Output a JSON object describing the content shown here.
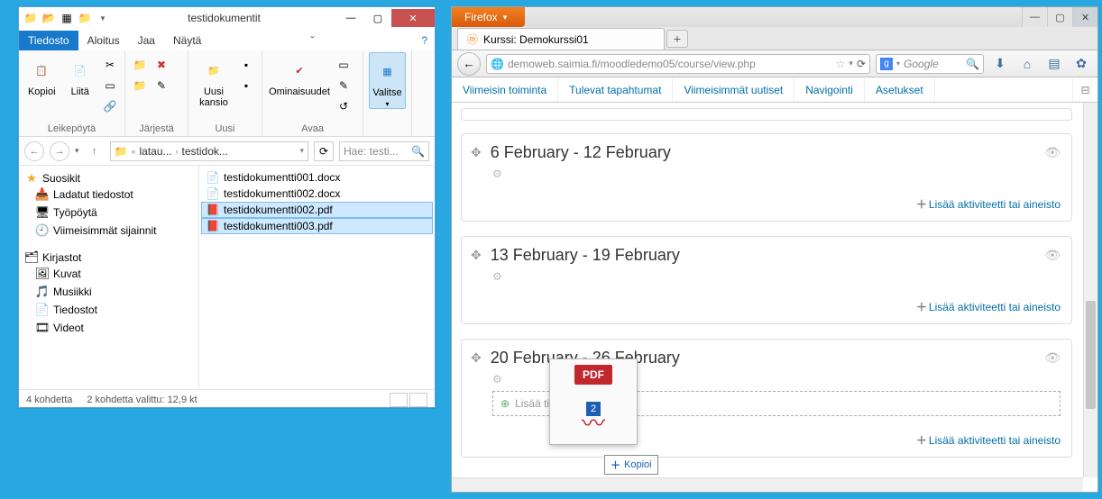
{
  "explorer": {
    "title": "testidokumentit",
    "tabs": {
      "tiedosto": "Tiedosto",
      "aloitus": "Aloitus",
      "jaa": "Jaa",
      "nayta": "Näytä"
    },
    "ribbon": {
      "kopioi": "Kopioi",
      "liita": "Liitä",
      "leikepoyta": "Leikepöytä",
      "jarjesta": "Järjestä",
      "uusi_kansio": "Uusi\nkansio",
      "uusi": "Uusi",
      "ominaisuudet": "Ominaisuudet",
      "avaa": "Avaa",
      "valitse": "Valitse"
    },
    "breadcrumb": {
      "seg1": "latau...",
      "seg2": "testidok..."
    },
    "search_placeholder": "Hae: testi...",
    "tree": {
      "suosikit": "Suosikit",
      "ladatut": "Ladatut tiedostot",
      "tyopoyta": "Työpöytä",
      "viimeisimmat": "Viimeisimmät sijainnit",
      "kirjastot": "Kirjastot",
      "kuvat": "Kuvat",
      "musiikki": "Musiikki",
      "tiedostot": "Tiedostot",
      "videot": "Videot"
    },
    "files": [
      {
        "name": "testidokumentti001.docx",
        "type": "docx",
        "selected": false
      },
      {
        "name": "testidokumentti002.docx",
        "type": "docx",
        "selected": false
      },
      {
        "name": "testidokumentti002.pdf",
        "type": "pdf",
        "selected": true
      },
      {
        "name": "testidokumentti003.pdf",
        "type": "pdf",
        "selected": true
      }
    ],
    "status": {
      "count": "4 kohdetta",
      "sel": "2 kohdetta valittu: 12,9 kt"
    }
  },
  "firefox": {
    "menu_label": "Firefox",
    "tab_title": "Kurssi: Demokurssi01",
    "url": "demoweb.saimia.fi/moodledemo05/course/view.php",
    "search_placeholder": "Google",
    "navtabs": {
      "viimeisin": "Viimeisin toiminta",
      "tulevat": "Tulevat tapahtumat",
      "uutiset": "Viimeisimmät uutiset",
      "navigointi": "Navigointi",
      "asetukset": "Asetukset"
    },
    "sections": [
      {
        "title": "6 February - 12 February",
        "add": "Lisää aktiviteetti tai aineisto"
      },
      {
        "title": "13 February - 19 February",
        "add": "Lisää aktiviteetti tai aineisto"
      },
      {
        "title": "20 February - 26 February",
        "add": "Lisää aktiviteetti tai aineisto",
        "dropzone": "Lisää tiedosto(t) tähän"
      }
    ],
    "drag": {
      "badge": "PDF",
      "count": "2",
      "tooltip": "Kopioi"
    }
  }
}
